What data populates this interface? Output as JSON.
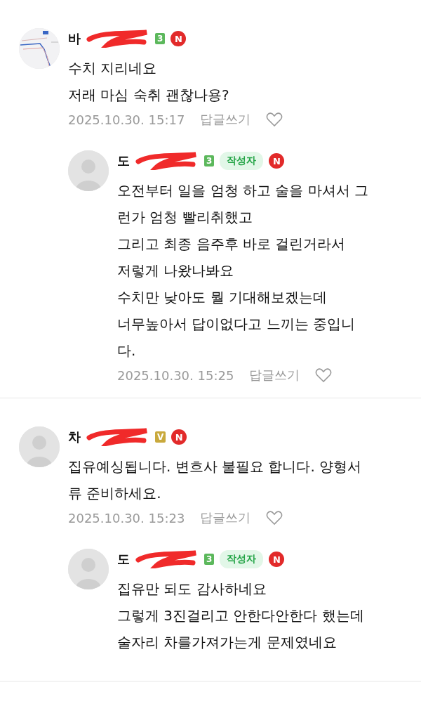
{
  "threads": [
    {
      "comment": {
        "avatar": {
          "kind": "picture"
        },
        "name": "바",
        "badge": {
          "kind": "level",
          "text": "3"
        },
        "new_mark": "N",
        "lines": [
          "수치 지리네요",
          "저래 마심 숙취 괜찮나용?"
        ],
        "date": "2025.10.30. 15:17",
        "reply": "답글쓰기"
      },
      "replies": [
        {
          "avatar": {
            "kind": "default"
          },
          "name": "도",
          "badge": {
            "kind": "level",
            "text": "3"
          },
          "author_label": "작성자",
          "new_mark": "N",
          "lines": [
            "오전부터 일을 엄청 하고 술을 마셔서 그",
            "런가 엄청 빨리취했고",
            "그리고 최종 음주후 바로 걸린거라서",
            "저렇게 나왔나봐요",
            "수치만 낮아도 뭘 기대해보겠는데",
            "너무높아서 답이없다고 느끼는 중입니",
            "다."
          ],
          "date": "2025.10.30. 15:25",
          "reply": "답글쓰기"
        }
      ]
    },
    {
      "comment": {
        "avatar": {
          "kind": "default"
        },
        "name": "차",
        "badge": {
          "kind": "vip",
          "text": "V"
        },
        "new_mark": "N",
        "lines": [
          "집유예싱됩니다. 변흐사 불필요 합니다. 양형서",
          "류 준비하세요."
        ],
        "date": "2025.10.30. 15:23",
        "reply": "답글쓰기"
      },
      "replies": [
        {
          "avatar": {
            "kind": "default"
          },
          "name": "도",
          "badge": {
            "kind": "level",
            "text": "3"
          },
          "author_label": "작성자",
          "new_mark": "N",
          "lines": [
            "집유만 되도 감사하네요",
            "그렇게 3진걸리고 안한다안한다 했는데",
            "술자리 차를가져가는게 문제였네요"
          ]
        }
      ]
    }
  ]
}
